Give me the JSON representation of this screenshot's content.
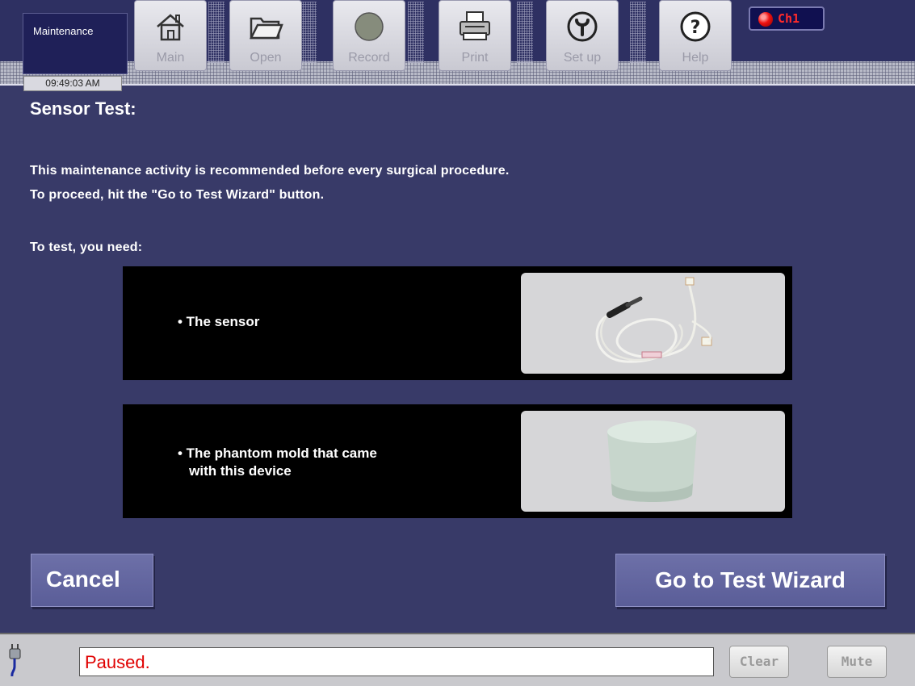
{
  "status": {
    "title": "Maintenance",
    "time": "09:49:03 AM"
  },
  "toolbar": {
    "main": "Main",
    "open": "Open",
    "record": "Record",
    "print": "Print",
    "setup": "Set up",
    "help": "Help",
    "channel": "Ch1"
  },
  "content": {
    "title": "Sensor Test:",
    "line1": "This maintenance activity is recommended before every surgical procedure.",
    "line2": "To proceed, hit the \"Go to Test Wizard\" button.",
    "need_label": "To test, you need:",
    "items": [
      {
        "text": "• The sensor",
        "image": "sensor-cable"
      },
      {
        "text": "• The phantom mold that came\n   with this device",
        "image": "phantom-mold"
      }
    ]
  },
  "buttons": {
    "cancel": "Cancel",
    "wizard": "Go to Test Wizard"
  },
  "bottom": {
    "message": "Paused.",
    "clear": "Clear",
    "mute": "Mute"
  },
  "colors": {
    "background": "#383a68",
    "message": "#e00000",
    "channel_led": "#ee1111"
  }
}
